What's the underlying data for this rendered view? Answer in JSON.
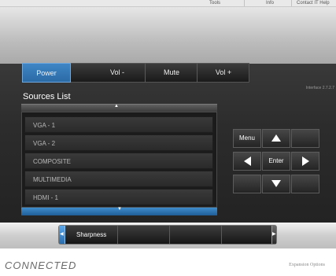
{
  "top_nav": {
    "tools": "Tools",
    "info": "Info",
    "contact": "Contact IT Help"
  },
  "controls": {
    "power": "Power",
    "vol_down": "Vol -",
    "mute": "Mute",
    "vol_up": "Vol +"
  },
  "version": "Interface 2.7.2.7",
  "sources": {
    "title": "Sources List",
    "items": [
      "VGA - 1",
      "VGA - 2",
      "COMPOSITE",
      "MULTIMEDIA",
      "HDMI - 1"
    ]
  },
  "pad": {
    "menu": "Menu",
    "enter": "Enter"
  },
  "slider": {
    "label": "Sharpness"
  },
  "footer": {
    "logo": "CONNECTED",
    "expansion": "Expansion Options"
  },
  "icons": {
    "scroll_up": "▲",
    "scroll_down": "▼",
    "arrow_up": "arrow-up-icon",
    "arrow_down": "arrow-down-icon",
    "arrow_left": "arrow-left-icon",
    "arrow_right": "arrow-right-icon",
    "slider_left": "◀",
    "slider_right": "▶"
  },
  "colors": {
    "accent": "#2f77b8",
    "panel": "#2b2b2b",
    "header": "#bdbdbd"
  }
}
